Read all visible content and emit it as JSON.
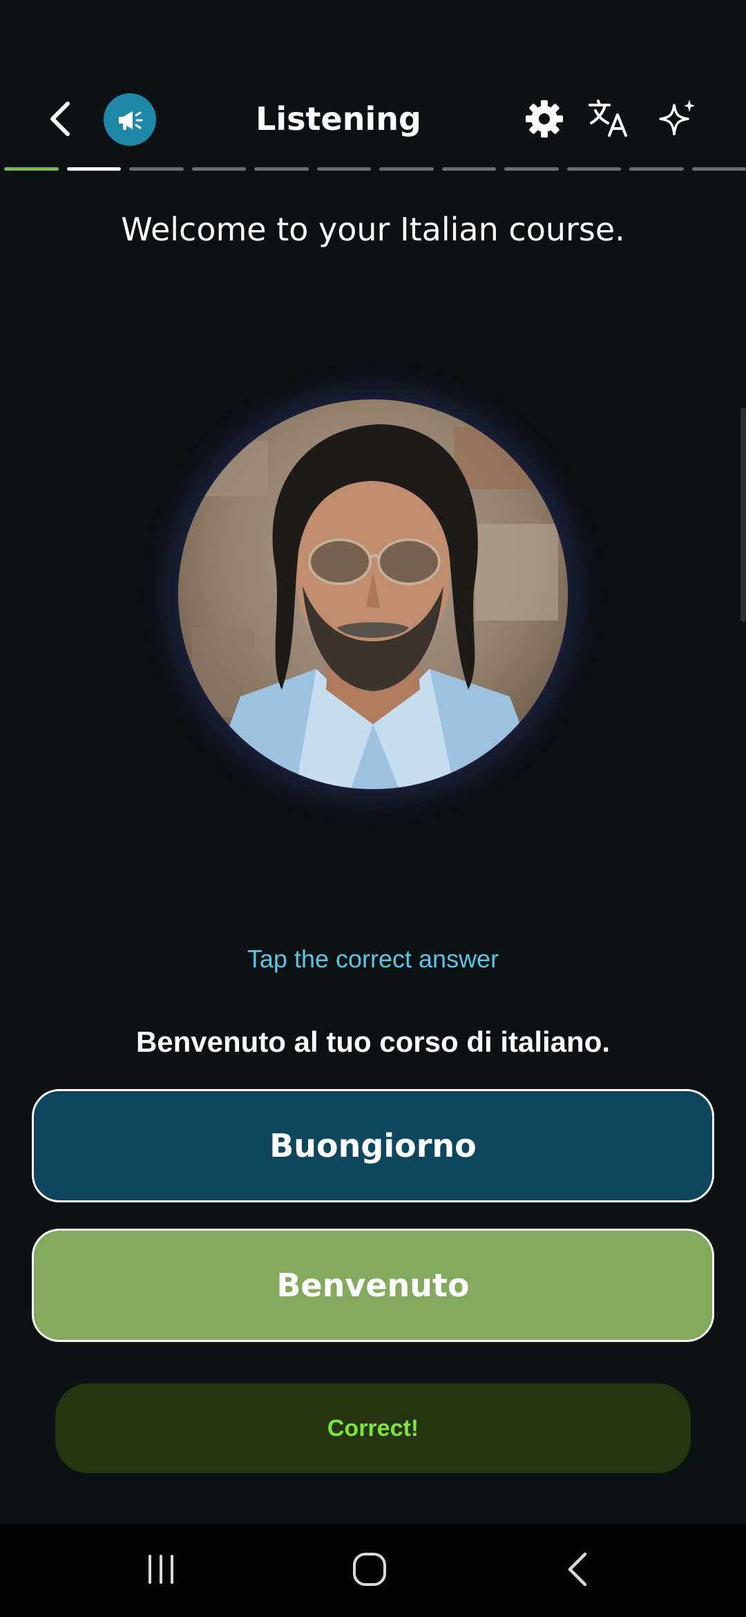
{
  "header": {
    "title": "Listening",
    "back_icon": "chevron-left-icon",
    "speaker_icon": "megaphone-icon",
    "settings_icon": "gear-icon",
    "translate_icon": "translate-icon",
    "ai_icon": "sparkle-icon"
  },
  "progress": {
    "total_steps": 12,
    "completed_steps": 1,
    "current_step": 2,
    "colors": {
      "done": "#7fb25c",
      "current": "#ffffff",
      "pending": "#6a6f72"
    }
  },
  "prompt": {
    "english_text": "Welcome to your Italian course."
  },
  "portrait": {
    "icon": "speaker-portrait"
  },
  "exercise": {
    "instruction": "Tap the correct answer",
    "sentence": "Benvenuto al tuo corso di italiano.",
    "options": [
      {
        "label": "Buongiorno",
        "state": "default",
        "color": "#0e465d"
      },
      {
        "label": "Benvenuto",
        "state": "correct",
        "color": "#82a95c"
      }
    ]
  },
  "feedback": {
    "text": "Correct!",
    "color": "#7ee33a",
    "background": "#263410"
  },
  "system_nav": {
    "recent_icon": "recent-apps-icon",
    "home_icon": "home-icon",
    "back_icon": "back-icon"
  }
}
